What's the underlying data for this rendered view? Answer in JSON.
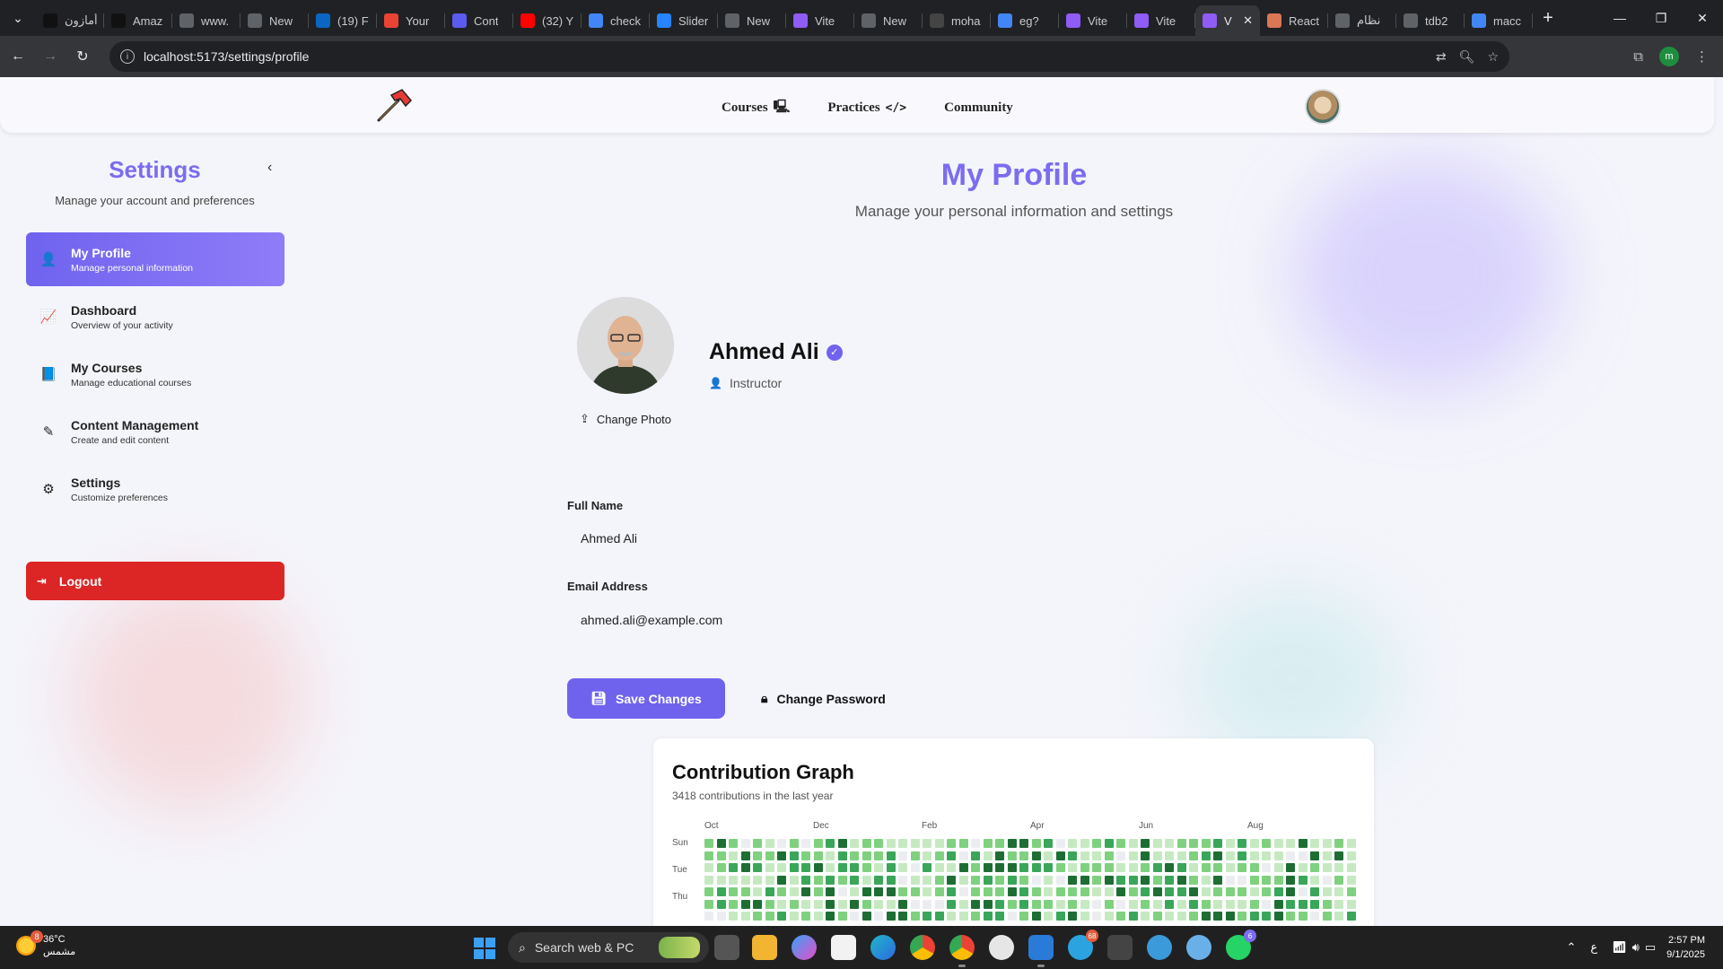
{
  "browser": {
    "tabs": [
      {
        "title": "أمازون",
        "icon": "amazon-icon",
        "color": "#111111"
      },
      {
        "title": "Amaz",
        "icon": "amazon-icon",
        "color": "#111111"
      },
      {
        "title": "www.",
        "icon": "globe-icon",
        "color": "#5f6368"
      },
      {
        "title": "New",
        "icon": "globe-icon",
        "color": "#5f6368"
      },
      {
        "title": "(19) F",
        "icon": "linkedin-icon",
        "color": "#0a66c2"
      },
      {
        "title": "Your",
        "icon": "gmail-icon",
        "color": "#ea4335"
      },
      {
        "title": "Cont",
        "icon": "app-icon",
        "color": "#5b5bf0"
      },
      {
        "title": "(32) Y",
        "icon": "youtube-icon",
        "color": "#ff0000"
      },
      {
        "title": "check",
        "icon": "google-icon",
        "color": "#4285f4"
      },
      {
        "title": "Slider",
        "icon": "jira-icon",
        "color": "#2684ff"
      },
      {
        "title": "New",
        "icon": "globe-icon",
        "color": "#5f6368"
      },
      {
        "title": "Vite",
        "icon": "vite-icon",
        "color": "#8f5cf6"
      },
      {
        "title": "New",
        "icon": "globe-icon",
        "color": "#5f6368"
      },
      {
        "title": "moha",
        "icon": "github-icon",
        "color": "#444444"
      },
      {
        "title": "eg?",
        "icon": "google-icon",
        "color": "#4285f4"
      },
      {
        "title": "Vite",
        "icon": "vite-icon",
        "color": "#8f5cf6"
      },
      {
        "title": "Vite",
        "icon": "vite-icon",
        "color": "#8f5cf6"
      },
      {
        "title": "V",
        "icon": "vite-icon",
        "color": "#8f5cf6",
        "active": true
      },
      {
        "title": "React",
        "icon": "claude-icon",
        "color": "#d97757"
      },
      {
        "title": "نظام",
        "icon": "globe-icon",
        "color": "#5f6368"
      },
      {
        "title": "tdb2",
        "icon": "globe-icon",
        "color": "#5f6368"
      },
      {
        "title": "macc",
        "icon": "google-icon",
        "color": "#4285f4"
      }
    ],
    "url": "localhost:5173/settings/profile",
    "profile_initial": "m"
  },
  "navbar": {
    "links": [
      {
        "label": "Courses",
        "icon": "laptop-icon",
        "icon_glyph": "🖳"
      },
      {
        "label": "Practices",
        "icon": "code-icon",
        "icon_glyph": "</>"
      },
      {
        "label": "Community",
        "icon": "",
        "icon_glyph": ""
      }
    ]
  },
  "sidebar": {
    "title": "Settings",
    "subtitle": "Manage your account and preferences",
    "items": [
      {
        "title": "My Profile",
        "desc": "Manage personal information",
        "icon": "user-icon",
        "glyph": "👤",
        "active": true
      },
      {
        "title": "Dashboard",
        "desc": "Overview of your activity",
        "icon": "chart-line-icon",
        "glyph": "📈"
      },
      {
        "title": "My Courses",
        "desc": "Manage educational courses",
        "icon": "book-icon",
        "glyph": "📘"
      },
      {
        "title": "Content Management",
        "desc": "Create and edit content",
        "icon": "edit-icon",
        "glyph": "✎"
      },
      {
        "title": "Settings",
        "desc": "Customize preferences",
        "icon": "gear-icon",
        "glyph": "⚙"
      }
    ],
    "logout_label": "Logout"
  },
  "profile": {
    "page_title": "My Profile",
    "page_subtitle": "Manage your personal information and settings",
    "change_photo_label": "Change Photo",
    "name": "Ahmed Ali",
    "role": "Instructor",
    "full_name_label": "Full Name",
    "full_name_value": "Ahmed Ali",
    "email_label": "Email Address",
    "email_value": "ahmed.ali@example.com",
    "save_label": "Save Changes",
    "change_password_label": "Change Password"
  },
  "contributions": {
    "title": "Contribution Graph",
    "summary": "3418 contributions in the last year",
    "months": [
      "Oct",
      "Dec",
      "Feb",
      "Apr",
      "Jun",
      "Aug"
    ],
    "days": [
      "Sun",
      "Tue",
      "Thu"
    ],
    "level_colors": [
      "#ebedf0",
      "#c6e9c2",
      "#7fd17f",
      "#3aa65a",
      "#1e6e34"
    ]
  },
  "taskbar": {
    "temperature": "36°C",
    "condition": "مشمس",
    "weather_badge": "8",
    "search_placeholder": "Search web & PC",
    "telegram_badge": "68",
    "whatsapp_badge": "6",
    "language": "ع",
    "time": "2:57 PM",
    "date": "9/1/2025"
  },
  "colors": {
    "accent": "#7b6cf0",
    "logout": "#dc2626",
    "page_bg": "#f4f5fb"
  }
}
